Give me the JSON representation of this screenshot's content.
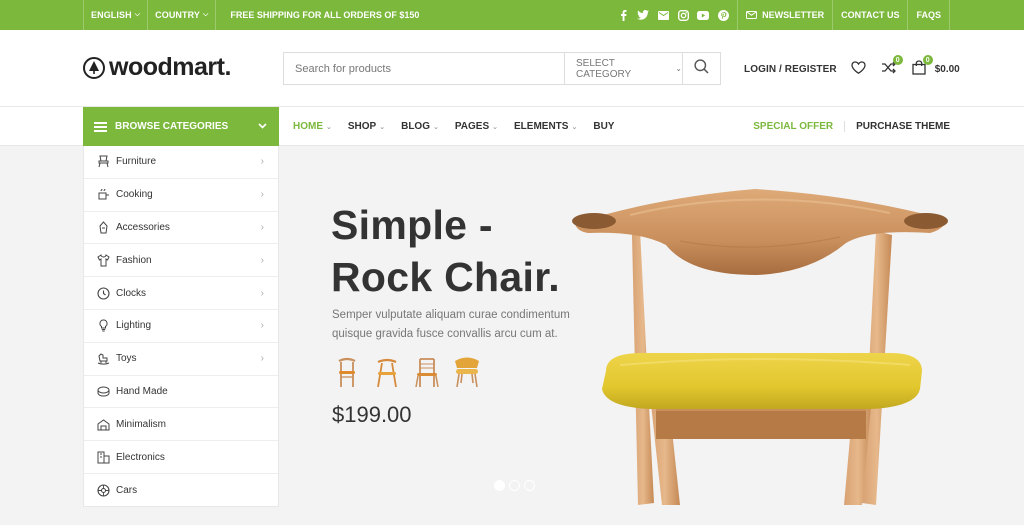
{
  "topbar": {
    "language": "ENGLISH",
    "country": "COUNTRY",
    "shipping": "FREE SHIPPING FOR ALL ORDERS OF $150",
    "social_icons": [
      "facebook-icon",
      "twitter-icon",
      "email-icon",
      "instagram-icon",
      "youtube-icon",
      "pinterest-icon"
    ],
    "newsletter": "NEWSLETTER",
    "contact": "CONTACT US",
    "faqs": "FAQS"
  },
  "header": {
    "logo": "woodmart.",
    "search_placeholder": "Search for products",
    "category": "SELECT CATEGORY",
    "login": "LOGIN / REGISTER",
    "compare_count": "0",
    "cart_count": "0",
    "cart_total": "$0.00"
  },
  "nav": {
    "browse": "BROWSE CATEGORIES",
    "items": [
      {
        "label": "HOME",
        "dropdown": true
      },
      {
        "label": "SHOP",
        "dropdown": true
      },
      {
        "label": "BLOG",
        "dropdown": true
      },
      {
        "label": "PAGES",
        "dropdown": true
      },
      {
        "label": "ELEMENTS",
        "dropdown": true
      },
      {
        "label": "BUY",
        "dropdown": false
      }
    ],
    "special_offer": "SPECIAL OFFER",
    "purchase": "PURCHASE THEME"
  },
  "categories": [
    {
      "label": "Furniture",
      "icon": "chair-icon",
      "has_sub": true
    },
    {
      "label": "Cooking",
      "icon": "cooking-icon",
      "has_sub": true
    },
    {
      "label": "Accessories",
      "icon": "accessories-icon",
      "has_sub": true
    },
    {
      "label": "Fashion",
      "icon": "shirt-icon",
      "has_sub": true
    },
    {
      "label": "Clocks",
      "icon": "clock-icon",
      "has_sub": true
    },
    {
      "label": "Lighting",
      "icon": "bulb-icon",
      "has_sub": true
    },
    {
      "label": "Toys",
      "icon": "toy-horse-icon",
      "has_sub": true
    },
    {
      "label": "Hand Made",
      "icon": "handmade-icon",
      "has_sub": false
    },
    {
      "label": "Minimalism",
      "icon": "minimalism-icon",
      "has_sub": false
    },
    {
      "label": "Electronics",
      "icon": "electronics-icon",
      "has_sub": false
    },
    {
      "label": "Cars",
      "icon": "car-wheel-icon",
      "has_sub": false
    }
  ],
  "hero": {
    "title_line1": "Simple -",
    "title_line2": "Rock Chair.",
    "description": "Semper vulputate aliquam curae condimentum quisque gravida fusce convallis arcu cum at.",
    "price": "$199.00",
    "slides_total": 3,
    "active_slide": 1
  },
  "colors": {
    "accent": "#7cb83c",
    "seat": "#e2c72e",
    "wood": "#c98f5c"
  }
}
